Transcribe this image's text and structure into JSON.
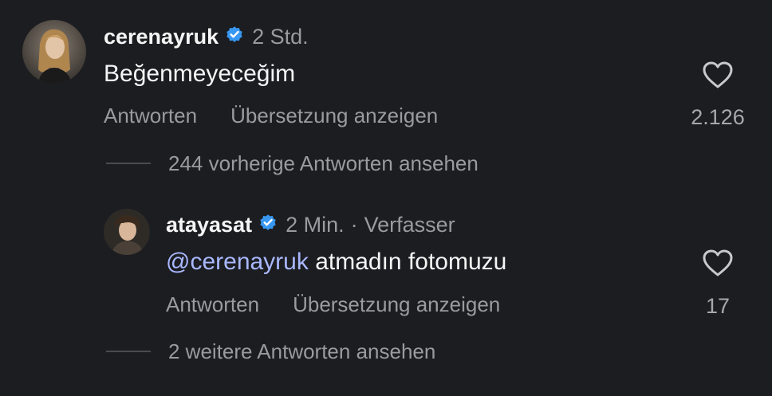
{
  "comment1": {
    "username": "cerenayruk",
    "time": "2 Std.",
    "text": "Beğenmeyeceğim",
    "reply_label": "Antworten",
    "translate_label": "Übersetzung anzeigen",
    "likes": "2.126"
  },
  "previous_replies": "244 vorherige Antworten ansehen",
  "reply1": {
    "username": "atayasat",
    "time": "2 Min.",
    "separator": "·",
    "author_badge": "Verfasser",
    "mention": "@cerenayruk",
    "text": "atmadın fotomuzu",
    "reply_label": "Antworten",
    "translate_label": "Übersetzung anzeigen",
    "likes": "17"
  },
  "more_replies": "2 weitere Antworten ansehen",
  "colors": {
    "background": "#1c1d21",
    "verified": "#3897f0",
    "mention": "#a9b8ff",
    "muted": "#9a9ba0"
  }
}
